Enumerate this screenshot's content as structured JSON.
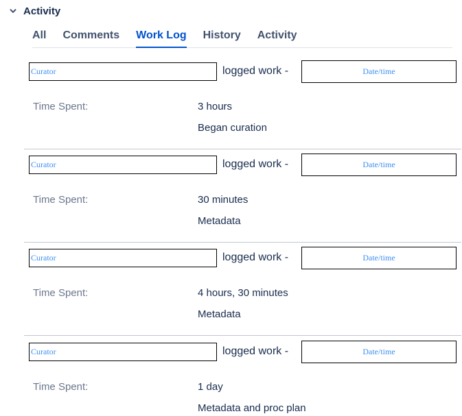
{
  "section": {
    "title": "Activity",
    "icon": "chevron-down-icon"
  },
  "tabs": [
    {
      "label": "All",
      "active": false
    },
    {
      "label": "Comments",
      "active": false
    },
    {
      "label": "Work Log",
      "active": true
    },
    {
      "label": "History",
      "active": false
    },
    {
      "label": "Activity",
      "active": false
    }
  ],
  "colors": {
    "accent": "#0052cc",
    "placeholder_text": "#3d8ff0",
    "label_text": "#6b778c"
  },
  "worklog": [
    {
      "author": "Curator",
      "action": "logged work -",
      "datetime": "Date/time",
      "time_spent_label": "Time Spent:",
      "time_spent": "3 hours",
      "comment": "Began curation"
    },
    {
      "author": "Curator",
      "action": "logged work -",
      "datetime": "Date/time",
      "time_spent_label": "Time Spent:",
      "time_spent": "30 minutes",
      "comment": "Metadata"
    },
    {
      "author": "Curator",
      "action": "logged work -",
      "datetime": "Date/time",
      "time_spent_label": "Time Spent:",
      "time_spent": "4 hours, 30 minutes",
      "comment": "Metadata"
    },
    {
      "author": "Curator",
      "action": "logged work -",
      "datetime": "Date/time",
      "time_spent_label": "Time Spent:",
      "time_spent": "1 day",
      "comment": "Metadata and proc plan"
    }
  ]
}
